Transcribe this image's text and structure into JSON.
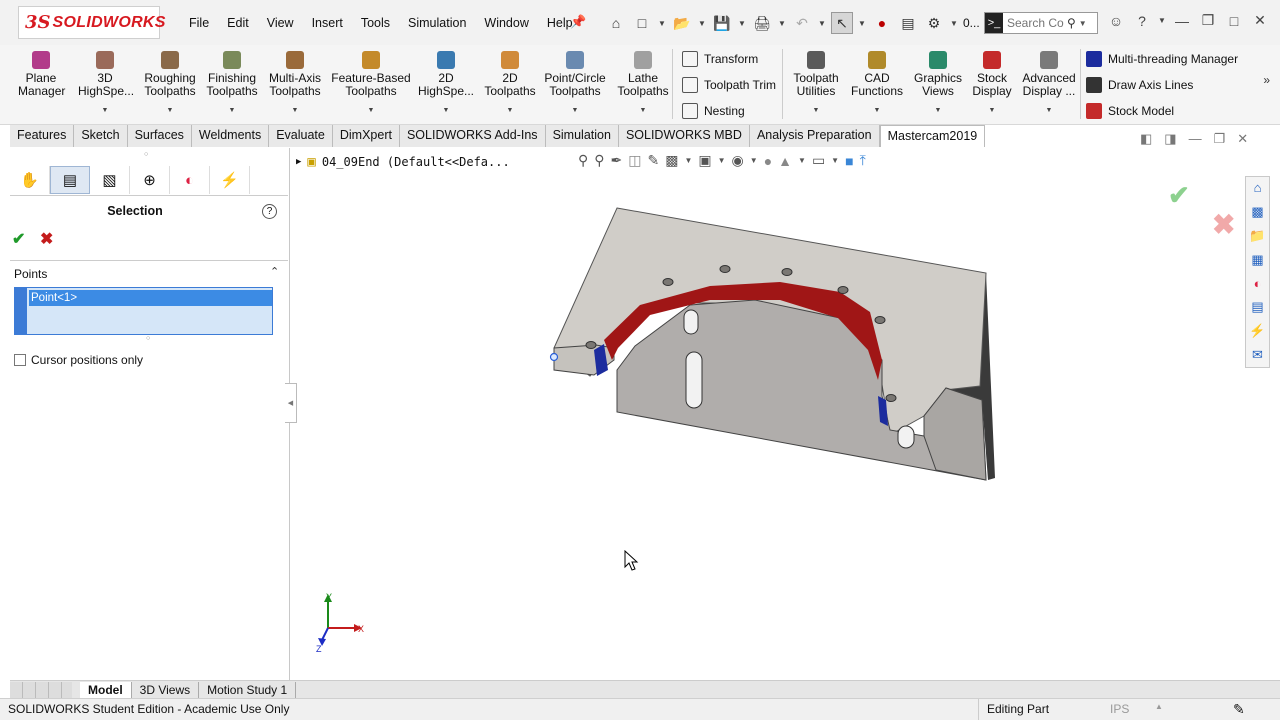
{
  "app": {
    "logo_ds": "3S",
    "logo_name": "SOLIDWORKS",
    "menu": [
      "File",
      "Edit",
      "View",
      "Insert",
      "Tools",
      "Simulation",
      "Window",
      "Help"
    ],
    "quick_counter": "0...",
    "search_placeholder": "Search Co"
  },
  "ribbon": {
    "buttons": [
      {
        "label": "Plane\nManager",
        "color": "#b23b8a"
      },
      {
        "label": "3D\nHighSpe...",
        "color": "#9a6a5a"
      },
      {
        "label": "Roughing\nToolpaths",
        "color": "#8a6a4a"
      },
      {
        "label": "Finishing\nToolpaths",
        "color": "#7a8a5a"
      },
      {
        "label": "Multi-Axis\nToolpaths",
        "color": "#9a6a3a"
      },
      {
        "label": "Feature-Based\nToolpaths",
        "color": "#c48a2a"
      },
      {
        "label": "2D\nHighSpe...",
        "color": "#3a7ab0"
      },
      {
        "label": "2D\nToolpaths",
        "color": "#d08a3a"
      },
      {
        "label": "Point/Circle\nToolpaths",
        "color": "#6a8ab0"
      },
      {
        "label": "Lathe\nToolpaths",
        "color": "#a0a0a0"
      },
      {
        "label": "Toolpath\nUtilities",
        "color": "#5a5a5a"
      },
      {
        "label": "CAD\nFunctions",
        "color": "#b08a2a"
      },
      {
        "label": "Graphics\nViews",
        "color": "#2a8a6a"
      },
      {
        "label": "Stock\nDisplay",
        "color": "#c42a2a"
      },
      {
        "label": "Advanced\nDisplay ...",
        "color": "#7a7a7a"
      }
    ],
    "small_group_1": [
      "Transform",
      "Toolpath Trim",
      "Nesting"
    ],
    "small_group_2": [
      "Multi-threading Manager",
      "Draw Axis Lines",
      "Stock Model"
    ]
  },
  "tabs": [
    "Features",
    "Sketch",
    "Surfaces",
    "Weldments",
    "Evaluate",
    "DimXpert",
    "SOLIDWORKS Add-Ins",
    "Simulation",
    "SOLIDWORKS MBD",
    "Analysis Preparation",
    "Mastercam2019"
  ],
  "active_tab": "Mastercam2019",
  "panel": {
    "title": "Selection",
    "section": "Points",
    "list_item": "Point<1>",
    "checkbox_label": "Cursor positions only"
  },
  "graphics": {
    "breadcrumb": "04_09End  (Default<<Defa..."
  },
  "triad": {
    "x": "X",
    "y": "Y",
    "z": "Z"
  },
  "bottom_tabs": [
    "Model",
    "3D Views",
    "Motion Study 1"
  ],
  "active_bottom_tab": "Model",
  "status": {
    "left": "SOLIDWORKS Student Edition - Academic Use Only",
    "mode": "Editing Part",
    "units": "IPS"
  }
}
